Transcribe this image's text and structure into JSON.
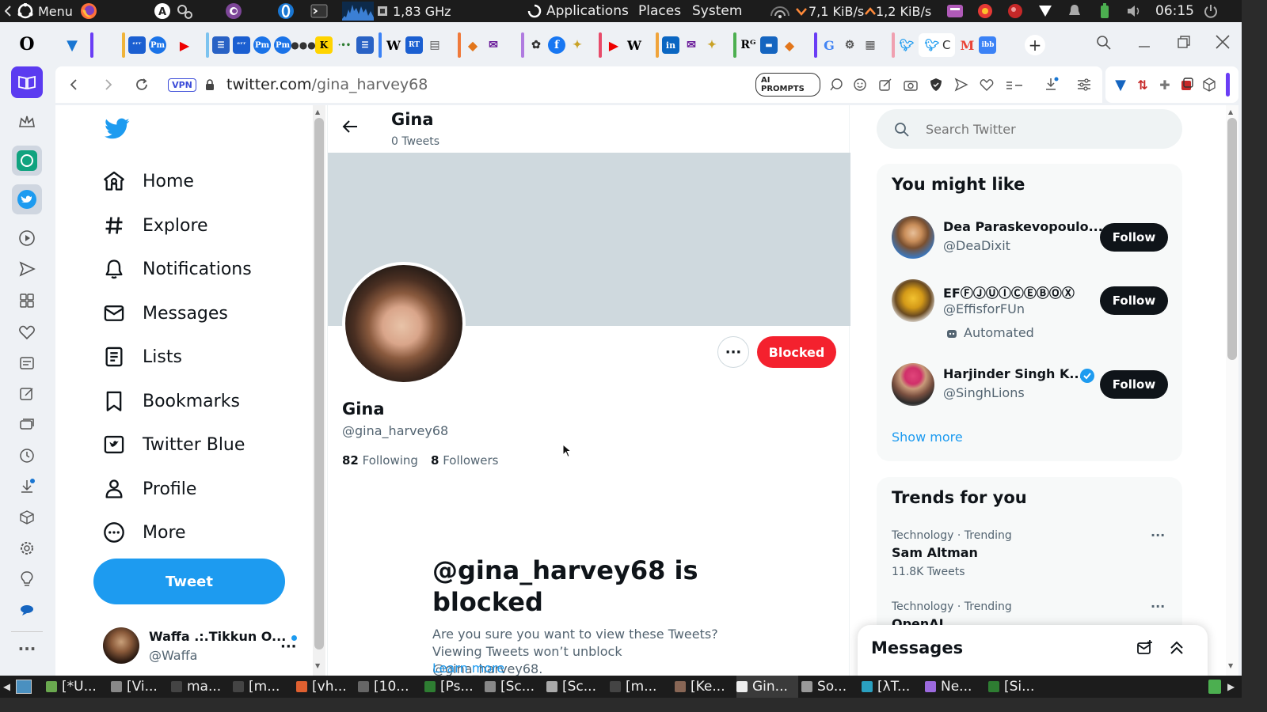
{
  "system_panel": {
    "menu_label": "Menu",
    "cpu_freq": "1,83 GHz",
    "applications": "Applications",
    "places": "Places",
    "system": "System",
    "net_down": "7,1 KiB/s",
    "net_up": "1,2 KiB/s",
    "clock": "06:15"
  },
  "browser": {
    "vpn_label": "VPN",
    "url_domain": "twitter.com",
    "url_path": "/gina_harvey68",
    "ai_prompts": "AI PROMPTS",
    "active_tab_fav": "C"
  },
  "nav": {
    "home": "Home",
    "explore": "Explore",
    "notifications": "Notifications",
    "messages": "Messages",
    "lists": "Lists",
    "bookmarks": "Bookmarks",
    "twitter_blue": "Twitter Blue",
    "profile": "Profile",
    "more": "More",
    "tweet_button": "Tweet",
    "account_name": "Waffa .:.Tikkun O...",
    "account_handle": "@Waffa"
  },
  "profile": {
    "header_name": "Gina",
    "header_tweets": "0 Tweets",
    "blocked_button": "Blocked",
    "name": "Gina",
    "handle": "@gina_harvey68",
    "following_count": "82",
    "following_label": "Following",
    "followers_count": "8",
    "followers_label": "Followers",
    "blocked_title": "@gina_harvey68 is blocked",
    "blocked_text": "Are you sure you want to view these Tweets? Viewing Tweets won’t unblock @gina_harvey68.",
    "learn_more": "Learn more"
  },
  "right": {
    "search_placeholder": "Search Twitter",
    "might_like_title": "You might like",
    "suggestions": [
      {
        "name": "Dea Paraskevopoulo...",
        "handle": "@DeaDixit",
        "follow": "Follow"
      },
      {
        "name": "EFⒻⒿⓊⒾⒸⒺⒷⓄⓍ",
        "handle": "@EffisforFUn",
        "badge": "Automated",
        "follow": "Follow"
      },
      {
        "name": "Harjinder Singh K...",
        "handle": "@SinghLions",
        "follow": "Follow"
      }
    ],
    "show_more": "Show more",
    "trends_title": "Trends for you",
    "trends": [
      {
        "meta": "Technology · Trending",
        "title": "Sam Altman",
        "count": "11.8K Tweets"
      },
      {
        "meta": "Technology · Trending",
        "title": "OpenAI"
      }
    ],
    "messages_title": "Messages"
  },
  "taskbar": [
    {
      "label": "[*U...",
      "color": "#6aa84f"
    },
    {
      "label": "[Vi...",
      "color": "#888888"
    },
    {
      "label": "ma...",
      "color": "#444444"
    },
    {
      "label": "[m...",
      "color": "#444444"
    },
    {
      "label": "[vh...",
      "color": "#e06030"
    },
    {
      "label": "[10...",
      "color": "#666666"
    },
    {
      "label": "[Ps...",
      "color": "#2e7d32"
    },
    {
      "label": "[Sc...",
      "color": "#888888"
    },
    {
      "label": "[Sc...",
      "color": "#aaaaaa"
    },
    {
      "label": "[m...",
      "color": "#444444"
    },
    {
      "label": "[Ke...",
      "color": "#886655"
    },
    {
      "label": "Gin...",
      "color": "#eeeeee"
    },
    {
      "label": "So...",
      "color": "#999999"
    },
    {
      "label": "[λT...",
      "color": "#2aa0c0"
    },
    {
      "label": "Ne...",
      "color": "#9c6ade"
    },
    {
      "label": "[Si...",
      "color": "#2e7d32"
    }
  ],
  "colors": {
    "twitter_blue": "#1d9bf0",
    "blocked_red": "#f4212e",
    "text_primary": "#0f1419",
    "text_secondary": "#536471"
  }
}
